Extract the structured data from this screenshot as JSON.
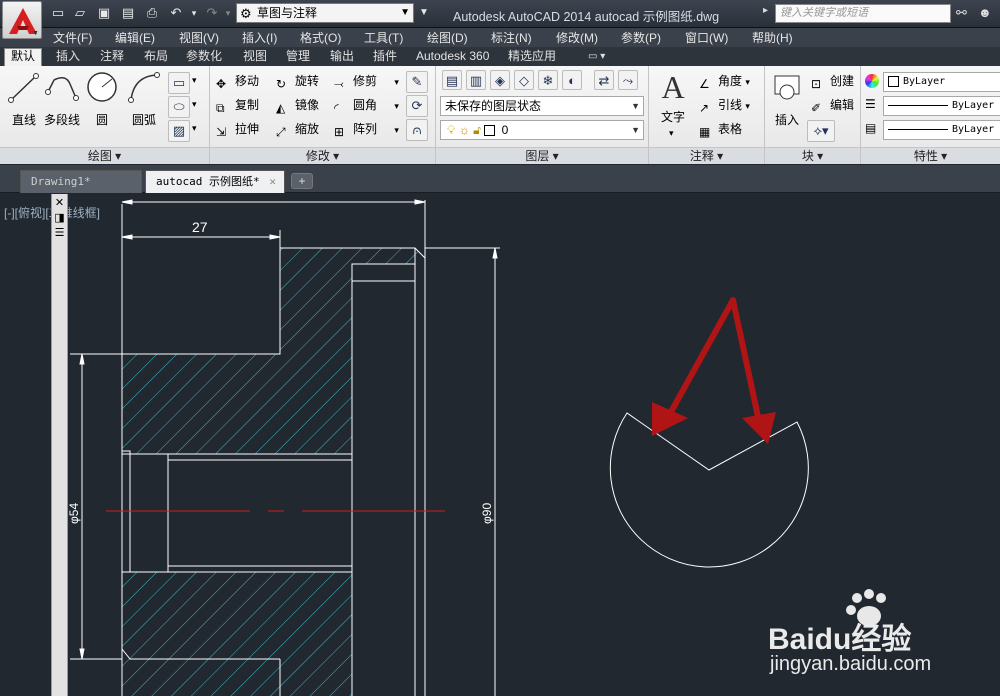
{
  "titlebar": {
    "workspace": "草图与注释",
    "title": "Autodesk AutoCAD 2014    autocad 示例图纸.dwg",
    "search_placeholder": "键入关键字或短语"
  },
  "menu": [
    "文件(F)",
    "编辑(E)",
    "视图(V)",
    "插入(I)",
    "格式(O)",
    "工具(T)",
    "绘图(D)",
    "标注(N)",
    "修改(M)",
    "参数(P)",
    "窗口(W)",
    "帮助(H)"
  ],
  "ribbon_tabs": [
    "默认",
    "插入",
    "注释",
    "布局",
    "参数化",
    "视图",
    "管理",
    "输出",
    "插件",
    "Autodesk 360",
    "精选应用"
  ],
  "panels": {
    "draw": {
      "label": "绘图",
      "tools": [
        "直线",
        "多段线",
        "圆",
        "圆弧"
      ]
    },
    "modify": {
      "label": "修改",
      "tools": [
        "移动",
        "旋转",
        "修剪",
        "复制",
        "镜像",
        "圆角",
        "拉伸",
        "缩放",
        "阵列"
      ]
    },
    "layers": {
      "label": "图层",
      "state": "未保存的图层状态",
      "current": "0"
    },
    "annotation": {
      "label": "注释",
      "text": "文字",
      "angle": "角度",
      "leader": "引线",
      "table": "表格"
    },
    "block": {
      "label": "块",
      "insert": "插入",
      "create": "创建",
      "edit": "编辑"
    },
    "properties": {
      "label": "特性",
      "color": "ByLayer",
      "linetype": "ByLayer",
      "lineweight": "ByLayer"
    }
  },
  "file_tabs": [
    "Drawing1*",
    "autocad 示例图纸*"
  ],
  "viewport": {
    "label": "[-][俯视][二维线框]"
  },
  "dimensions": {
    "top": "27",
    "left": "φ54",
    "right": "φ90"
  },
  "watermark": {
    "brand": "Baidu经验",
    "url": "jingyan.baidu.com"
  },
  "colors": {
    "background": "#212830",
    "hatch": "#3fb8c6",
    "line": "#ffffff",
    "center_line": "#c81e1e",
    "arrow": "#b01414"
  }
}
